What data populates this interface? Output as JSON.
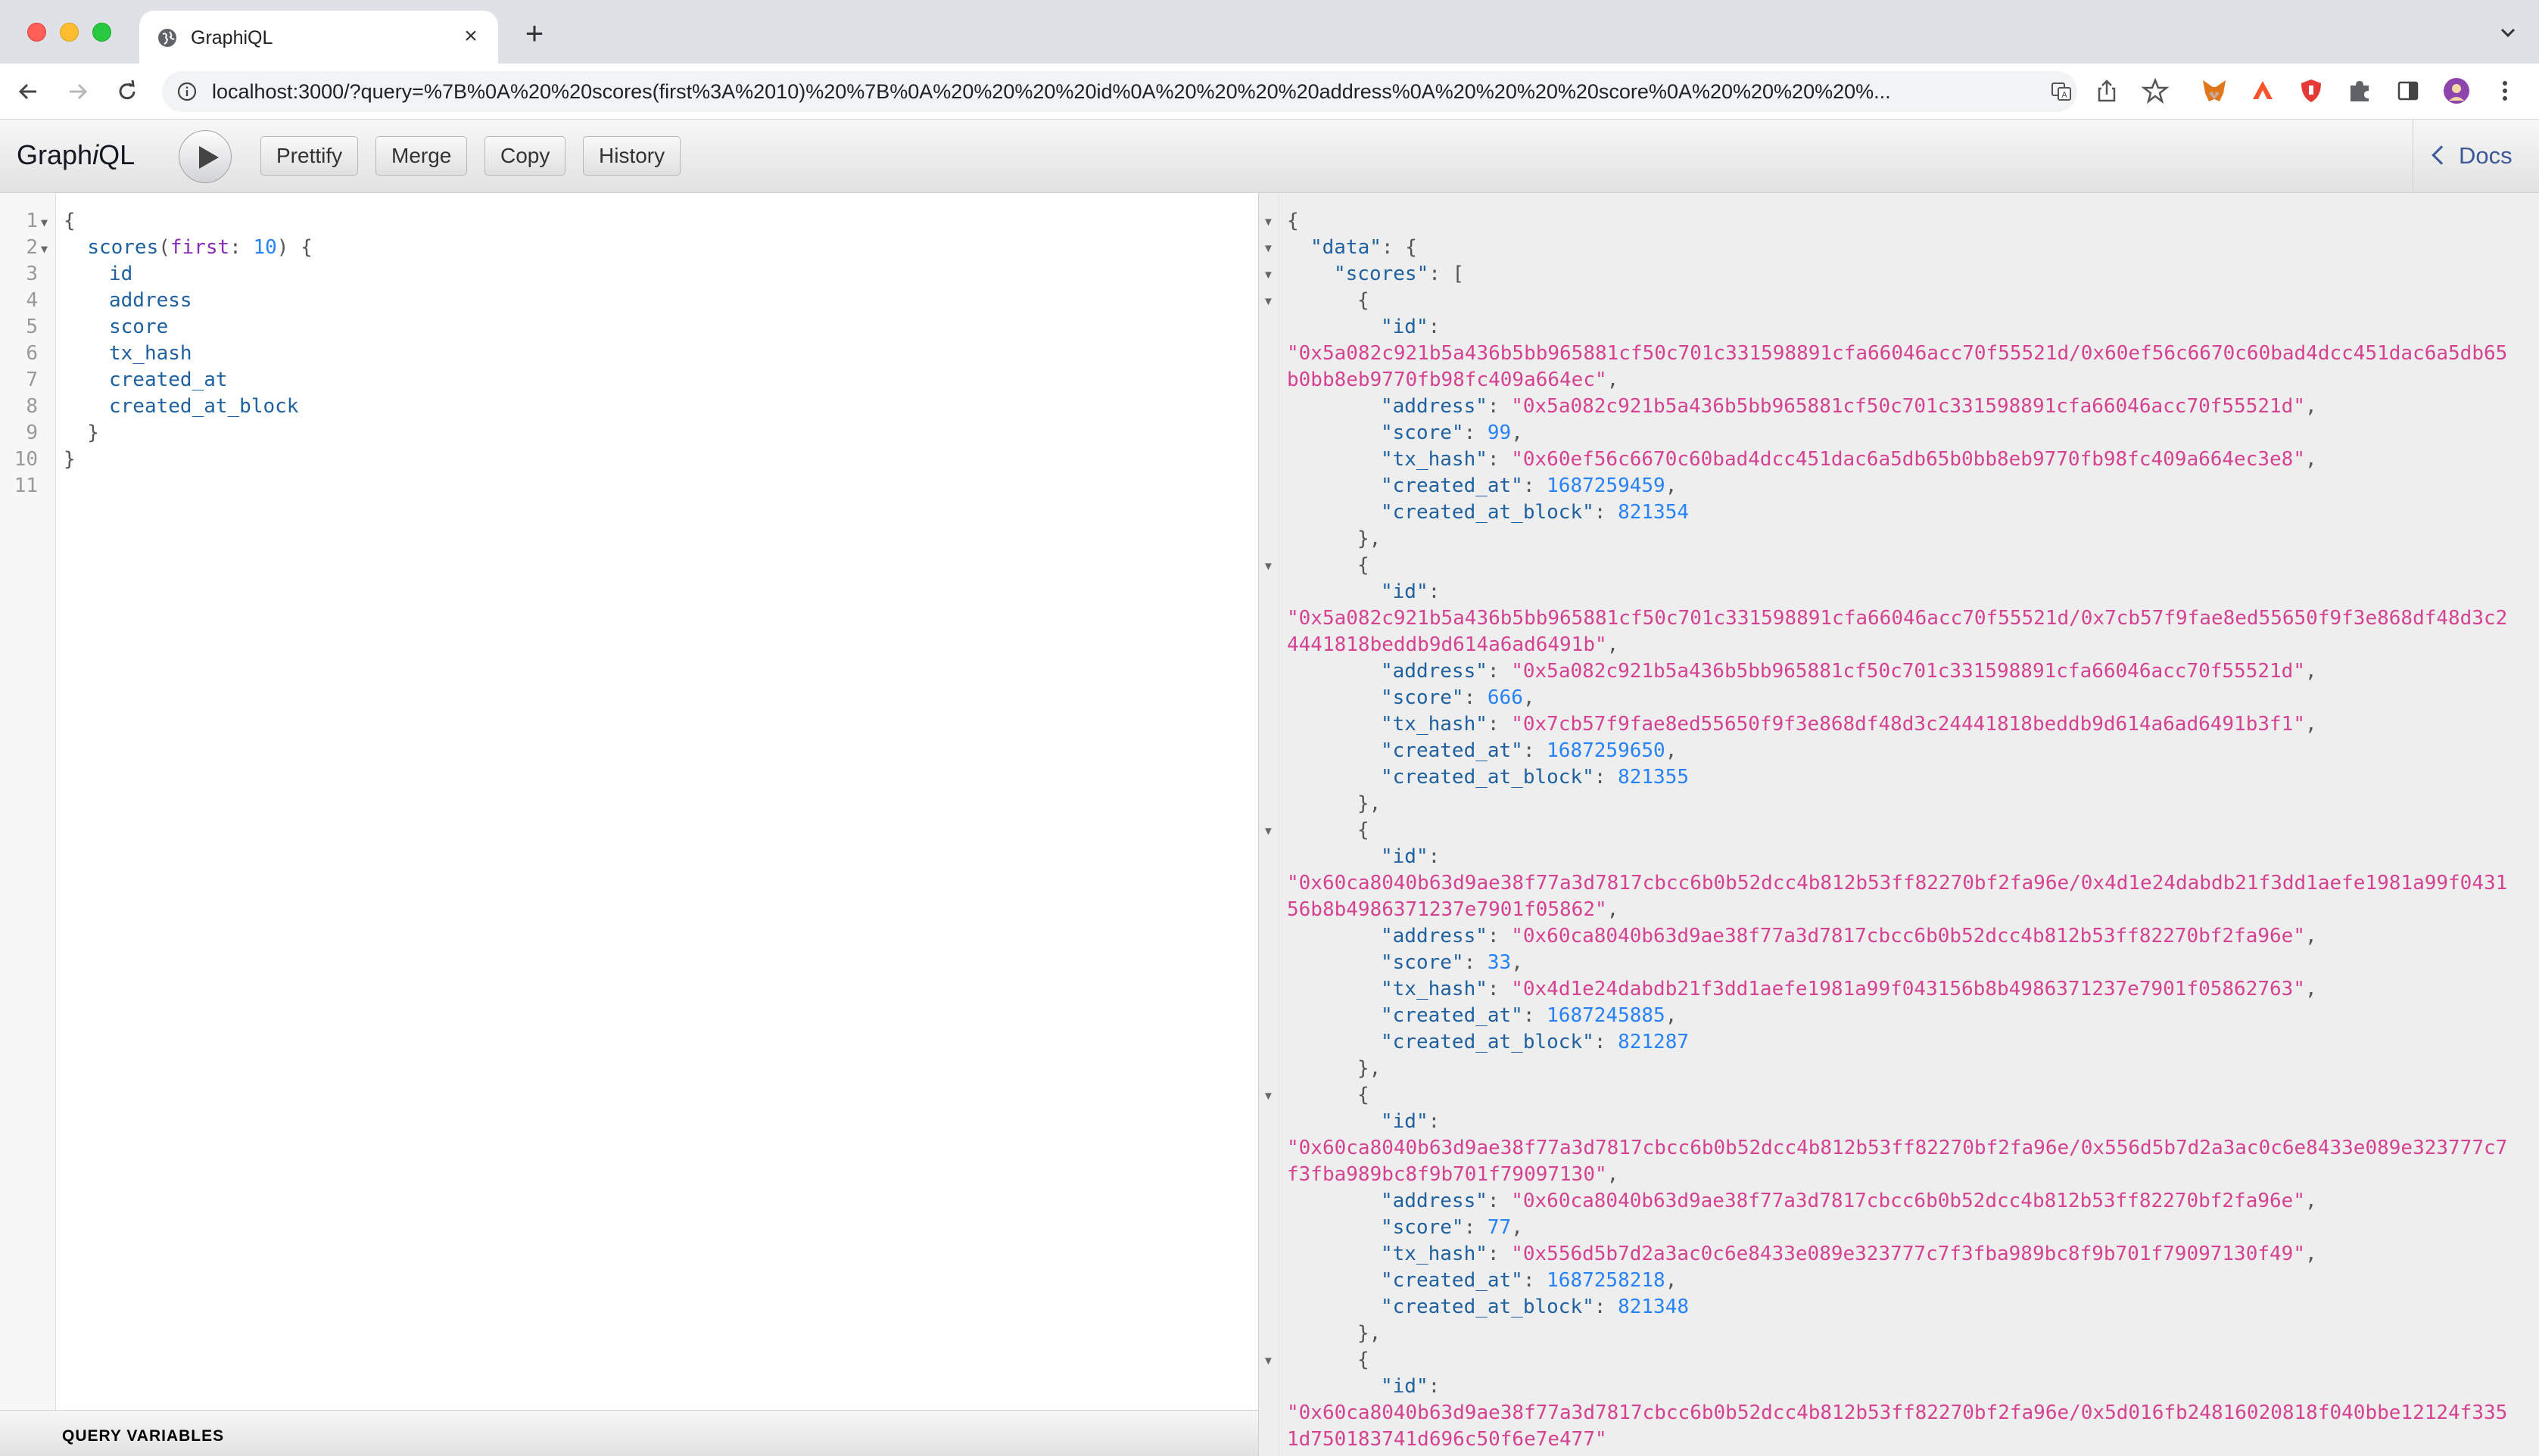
{
  "browser": {
    "tab_title": "GraphiQL",
    "new_tab_label": "+",
    "url": "localhost:3000/?query=%7B%0A%20%20scores(first%3A%2010)%20%7B%0A%20%20%20%20id%0A%20%20%20%20address%0A%20%20%20%20score%0A%20%20%20%20%..."
  },
  "graphiql": {
    "title_prefix": "Graph",
    "title_italic": "i",
    "title_suffix": "QL",
    "buttons": {
      "prettify": "Prettify",
      "merge": "Merge",
      "copy": "Copy",
      "history": "History"
    },
    "docs_label": "Docs",
    "query_variables_label": "QUERY VARIABLES",
    "query": {
      "line_numbers": [
        "1",
        "2",
        "3",
        "4",
        "5",
        "6",
        "7",
        "8",
        "9",
        "10",
        "11"
      ],
      "lines": [
        "{",
        "  scores(first: 10) {",
        "    id",
        "    address",
        "    score",
        "    tx_hash",
        "    created_at",
        "    created_at_block",
        "  }",
        "}",
        ""
      ],
      "root_field": "scores",
      "arg_name": "first",
      "arg_value": "10",
      "fields": [
        "id",
        "address",
        "score",
        "tx_hash",
        "created_at",
        "created_at_block"
      ]
    },
    "result": {
      "open_lines": [
        "{",
        "\"data\": {",
        "\"scores\": ["
      ],
      "records": [
        {
          "id_part1": "\"0x5a082c921b5a436b5bb965881cf50c701c331598891cfa66046acc70f55521d/0x60ef56c6670c60bad4dcc451dac6a5db65",
          "id_part2": "b0bb8eb9770fb98fc409a664ec\"",
          "address": "\"0x5a082c921b5a436b5bb965881cf50c701c331598891cfa66046acc70f55521d\"",
          "score": "99",
          "tx_hash": "\"0x60ef56c6670c60bad4dcc451dac6a5db65b0bb8eb9770fb98fc409a664ec3e8\"",
          "created_at": "1687259459",
          "created_at_block": "821354"
        },
        {
          "id_part1": "\"0x5a082c921b5a436b5bb965881cf50c701c331598891cfa66046acc70f55521d/0x7cb57f9fae8ed55650f9f3e868df48d3c2",
          "id_part2": "4441818beddb9d614a6ad6491b\"",
          "address": "\"0x5a082c921b5a436b5bb965881cf50c701c331598891cfa66046acc70f55521d\"",
          "score": "666",
          "tx_hash": "\"0x7cb57f9fae8ed55650f9f3e868df48d3c24441818beddb9d614a6ad6491b3f1\"",
          "created_at": "1687259650",
          "created_at_block": "821355"
        },
        {
          "id_part1": "\"0x60ca8040b63d9ae38f77a3d7817cbcc6b0b52dcc4b812b53ff82270bf2fa96e/0x4d1e24dabdb21f3dd1aefe1981a99f0431",
          "id_part2": "56b8b4986371237e7901f05862\"",
          "address": "\"0x60ca8040b63d9ae38f77a3d7817cbcc6b0b52dcc4b812b53ff82270bf2fa96e\"",
          "score": "33",
          "tx_hash": "\"0x4d1e24dabdb21f3dd1aefe1981a99f043156b8b4986371237e7901f05862763\"",
          "created_at": "1687245885",
          "created_at_block": "821287"
        },
        {
          "id_part1": "\"0x60ca8040b63d9ae38f77a3d7817cbcc6b0b52dcc4b812b53ff82270bf2fa96e/0x556d5b7d2a3ac0c6e8433e089e323777c7",
          "id_part2": "f3fba989bc8f9b701f79097130\"",
          "address": "\"0x60ca8040b63d9ae38f77a3d7817cbcc6b0b52dcc4b812b53ff82270bf2fa96e\"",
          "score": "77",
          "tx_hash": "\"0x556d5b7d2a3ac0c6e8433e089e323777c7f3fba989bc8f9b701f79097130f49\"",
          "created_at": "1687258218",
          "created_at_block": "821348"
        },
        {
          "id_part1": "\"0x60ca8040b63d9ae38f77a3d7817cbcc6b0b52dcc4b812b53ff82270bf2fa96e/0x5d016fb24816020818f040bbe12124f335",
          "id_part2": "1d750183741d696c50f6e7e477\""
        }
      ]
    }
  },
  "colors": {
    "key": "#1f61a0",
    "string": "#d64292",
    "number": "#2882f9",
    "link": "#3b5998"
  }
}
